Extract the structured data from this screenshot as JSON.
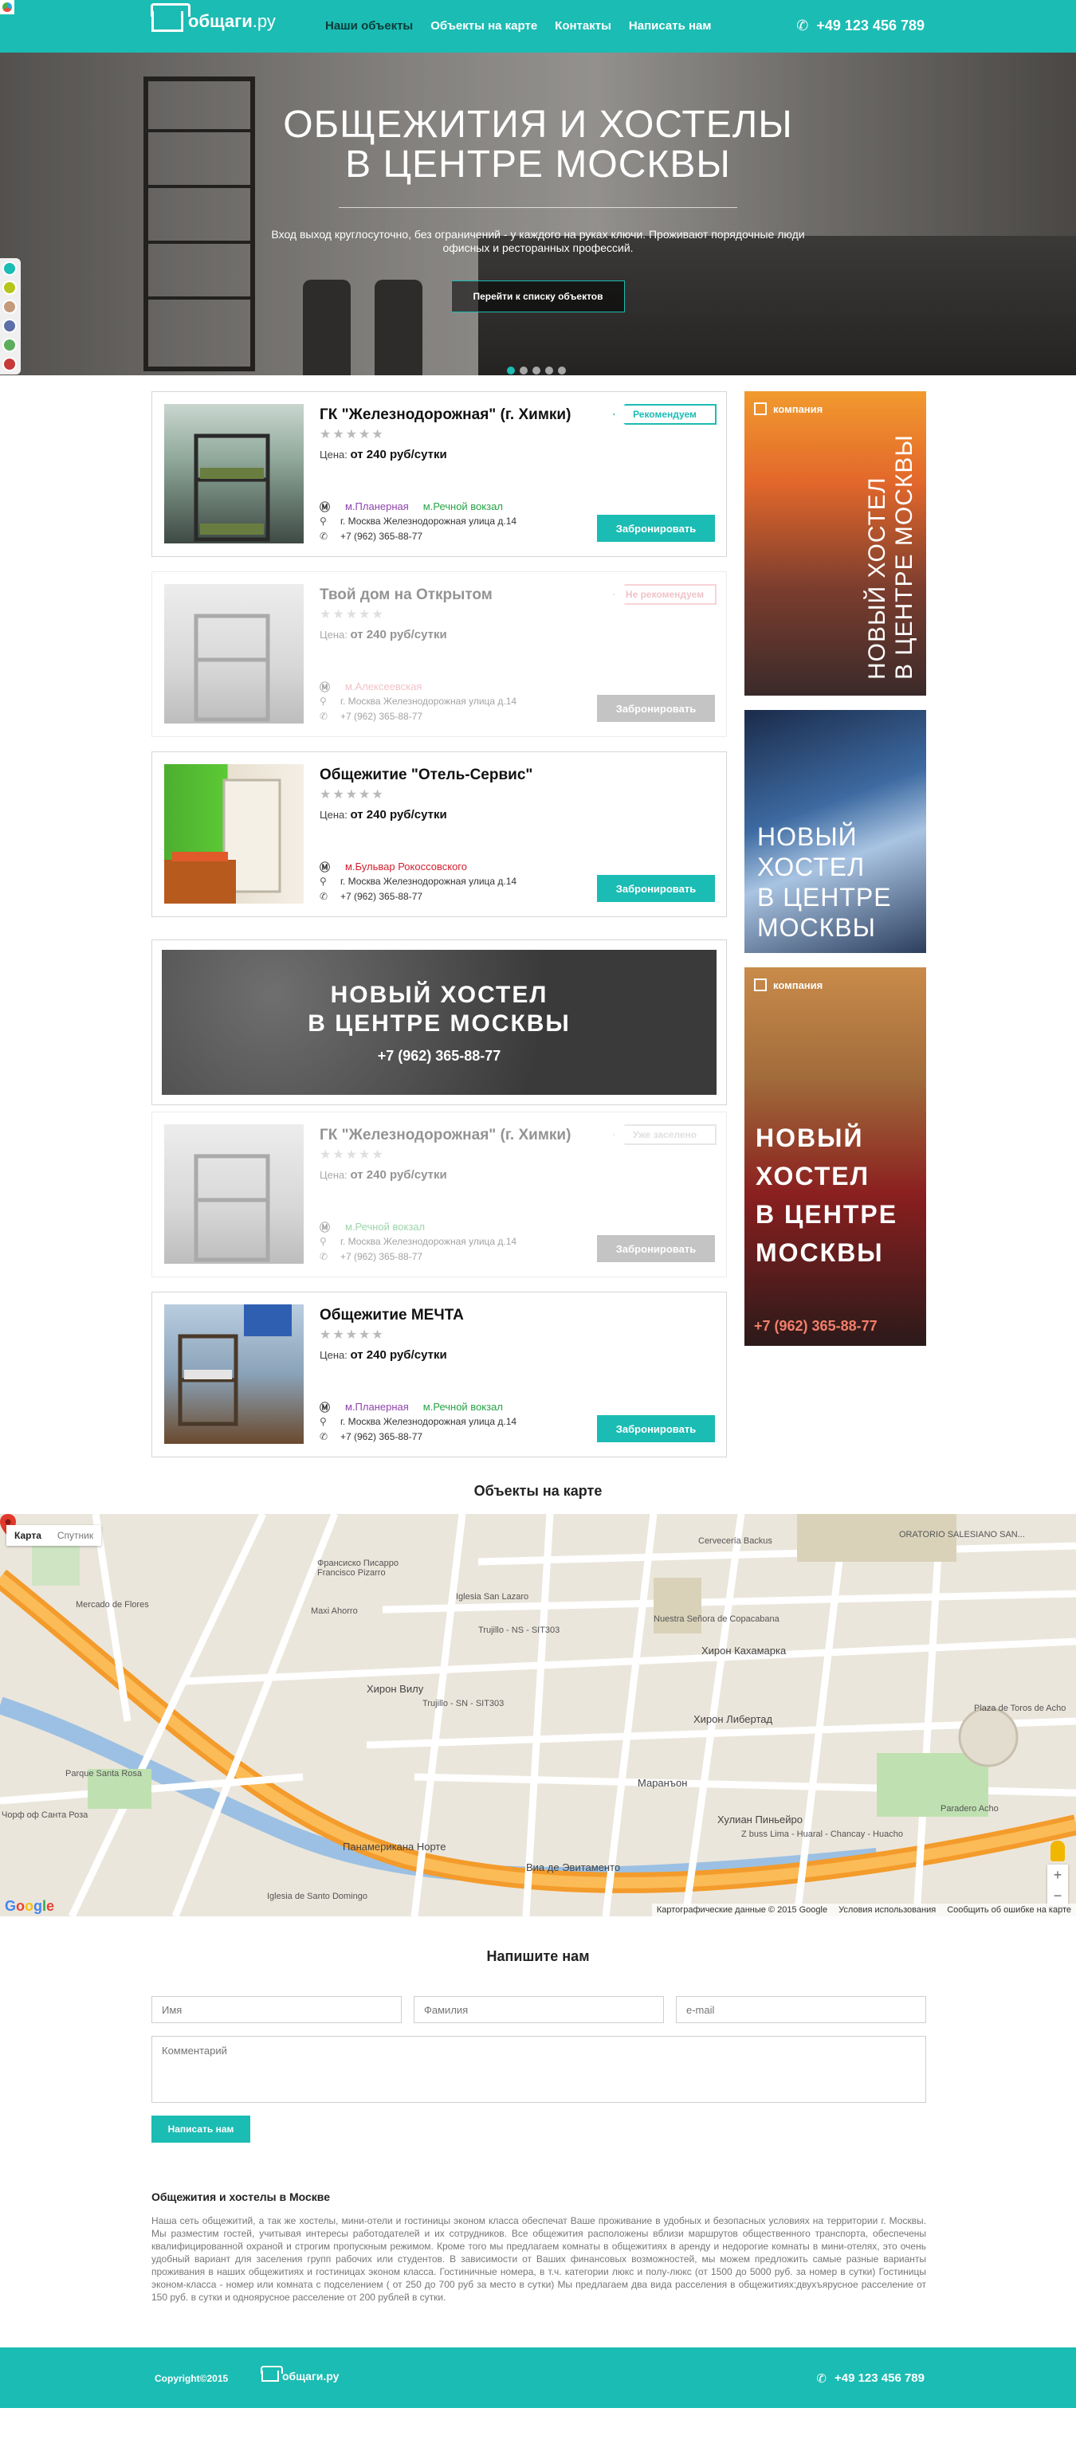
{
  "header": {
    "logo_main": "общаги",
    "logo_suffix": ".ру",
    "nav": [
      "Наши объекты",
      "Объекты на карте",
      "Контакты",
      "Написать нам"
    ],
    "phone": "+49 123 456 789"
  },
  "hero": {
    "title_line1": "ОБЩЕЖИТИЯ И ХОСТЕЛЫ",
    "title_line2": "В ЦЕНТРЕ МОСКВЫ",
    "text": "Вход выход круглосуточно, без ограничений - у каждого на руках ключи. Проживают порядочные люди офисных и ресторанных профессий.",
    "button": "Перейти к списку объектов",
    "slides_total": 5,
    "slide_active": 1,
    "palette_colors": [
      "#1bbcb3",
      "#b6c51b",
      "#c59a7a",
      "#5c6fa8",
      "#5cae5c",
      "#c83a3a"
    ]
  },
  "listings": [
    {
      "title": "ГК \"Железнодорожная\" (г. Химки)",
      "badge": "Рекомендуем",
      "price_label": "Цена:",
      "price_value": "от 240 руб/сутки",
      "metro": [
        "м.Планерная",
        "м.Речной вокзал"
      ],
      "address": "г. Москва Железнодорожная улица д.14",
      "phone": "+7 (962) 365-88-77",
      "button": "Забронировать",
      "rating": 0
    },
    {
      "title": "Твой дом на Открытом",
      "badge": "Не рекомендуем",
      "price_label": "Цена:",
      "price_value": "от 240 руб/сутки",
      "metro": [
        "м.Алексеевская"
      ],
      "address": "г. Москва Железнодорожная улица д.14",
      "phone": "+7 (962) 365-88-77",
      "button": "Забронировать",
      "rating": 0
    },
    {
      "title": "Общежитие \"Отель-Сервис\"",
      "badge": "",
      "price_label": "Цена:",
      "price_value": "от 240 руб/сутки",
      "metro": [
        "м.Бульвар Рокоссовского"
      ],
      "address": "г. Москва Железнодорожная улица д.14",
      "phone": "+7 (962) 365-88-77",
      "button": "Забронировать",
      "rating": 0
    },
    {
      "title": "ГК \"Железнодорожная\" (г. Химки)",
      "badge": "Уже заселено",
      "price_label": "Цена:",
      "price_value": "от 240 руб/сутки",
      "metro": [
        "м.Речной вокзал"
      ],
      "address": "г. Москва Железнодорожная улица д.14",
      "phone": "+7 (962) 365-88-77",
      "button": "Забронировать",
      "rating": 0
    },
    {
      "title": "Общежитие МЕЧТА",
      "badge": "",
      "price_label": "Цена:",
      "price_value": "от 240 руб/сутки",
      "metro": [
        "м.Планерная",
        "м.Речной вокзал"
      ],
      "address": "г. Москва Железнодорожная улица д.14",
      "phone": "+7 (962) 365-88-77",
      "button": "Забронировать",
      "rating": 0
    }
  ],
  "banner": {
    "line1": "НОВЫЙ ХОСТЕЛ",
    "line2": "В ЦЕНТРЕ МОСКВЫ",
    "phone": "+7 (962) 365-88-77"
  },
  "ads": [
    {
      "tag": "компания",
      "lines": [
        "НОВЫЙ ХОСТЕЛ",
        "В ЦЕНТРЕ МОСКВЫ"
      ]
    },
    {
      "tag": "",
      "lines": [
        "НОВЫЙ",
        "ХОСТЕЛ",
        "В ЦЕНТРЕ",
        "МОСКВЫ"
      ]
    },
    {
      "tag": "компания",
      "lines": [
        "НОВЫЙ",
        "ХОСТЕЛ",
        "В ЦЕНТРЕ",
        "МОСКВЫ"
      ],
      "phone": "+7 (962) 365-88-77"
    }
  ],
  "map": {
    "title": "Объекты на карте",
    "tab_map": "Карта",
    "tab_sat": "Спутник",
    "labels": [
      "Francisco Pizarro",
      "Франсиско Писарро",
      "Mercado de Flores",
      "Maxi Ahorro",
      "Iglesia San Lazaro",
      "Trujillo - NS - SIT303",
      "Nuestra Señora de Copacabana",
      "Хирон Кахамарка",
      "Хирон Вилу",
      "Trujillo - SN - SIT303",
      "Хирон Либертад",
      "Plaza de Toros de Acho",
      "Parque Santa Rosa",
      "Маранъон",
      "Хулиан Пиньейро",
      "Z buss Lima - Huaral - Chancay - Huacho",
      "Paradero Acho",
      "Виа де Эвитаменто",
      "Панамерикана Норте",
      "Iglesia de Santo Domingo",
      "Cervecería Backus",
      "ORATORIO SALESIANO SAN...",
      "Чорф оф Санта Роза"
    ],
    "footer": [
      "Картографические данные © 2015 Google",
      "Условия использования",
      "Сообщить об ошибке на карте"
    ]
  },
  "contact": {
    "title": "Напишите нам",
    "name_ph": "Имя",
    "surname_ph": "Фамилия",
    "email_ph": "e-mail",
    "comment_ph": "Комментарий",
    "button": "Написать нам"
  },
  "seo": {
    "title": "Общежития и хостелы в Москве",
    "text": "Наша сеть общежитий, а так же хостелы, мини-отели и гостиницы эконом класса обеспечат Ваше проживание в удобных и безопасных условиях на территории г. Москвы. Мы разместим гостей, учитывая интересы работодателей и их сотрудников. Все общежития расположены вблизи маршрутов общественного транспорта, обеспечены квалифицированной охраной и строгим пропускным режимом. Кроме того мы предлагаем комнаты в общежитиях в аренду и недорогие комнаты в мини-отелях, это очень удобный вариант для заселения групп рабочих или студентов. В зависимости от Ваших финансовых возможностей, мы можем предложить самые разные варианты проживания в наших общежитиях и гостиницах эконом класса. Гостиничные номера, в т.ч. категории люкс и полу-люкс (от 1500 до 5000 руб. за номер в сутки) Гостиницы эконом-класса - номер или комната с подселением ( от 250 до 700 руб за место в сутки) Мы предлагаем два вида расселения в общежитиях:двухъярусное расселение от 150 руб. в сутки и одноярусное расселение от 200 рублей в сутки."
  },
  "footer": {
    "copyright": "Copyright©2015",
    "logo": "общаги.ру",
    "phone": "+49 123 456 789"
  }
}
